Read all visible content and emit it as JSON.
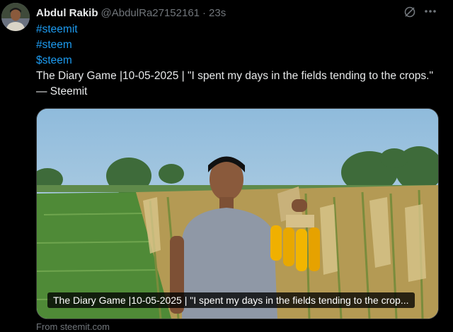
{
  "author": {
    "name": "Abdul Rakib",
    "handle": "@AbdulRa27152161",
    "separator": "·",
    "time": "23s"
  },
  "tweet": {
    "hashtags": [
      "#steemit",
      "#steem",
      "$steem"
    ],
    "text": "The Diary Game |10-05-2025 | \"I spent my days in the fields tending to the crops.\" — Steemit"
  },
  "media": {
    "caption": "The Diary Game |10-05-2025 | \"I spent my days in the fields tending to the crop..."
  },
  "card": {
    "source": "From steemit.com"
  },
  "icons": {
    "grok": "grok-icon",
    "more": "more-icon"
  },
  "colors": {
    "link": "#1d9bf0",
    "background": "#000000",
    "muted": "#71767b"
  }
}
